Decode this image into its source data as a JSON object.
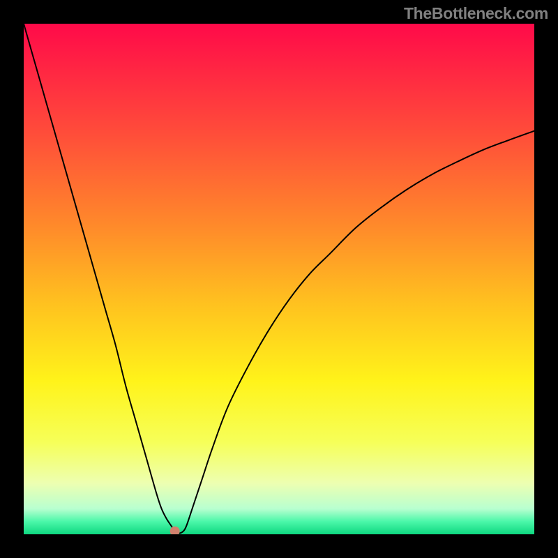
{
  "attribution": "TheBottleneck.com",
  "chart_data": {
    "type": "line",
    "title": "",
    "xlabel": "",
    "ylabel": "",
    "xlim": [
      0,
      100
    ],
    "ylim": [
      0,
      100
    ],
    "background": {
      "type": "vertical-gradient",
      "stops": [
        {
          "pos": 0.0,
          "color": "#ff0a49"
        },
        {
          "pos": 0.2,
          "color": "#ff483b"
        },
        {
          "pos": 0.4,
          "color": "#ff8b2a"
        },
        {
          "pos": 0.55,
          "color": "#ffc21f"
        },
        {
          "pos": 0.7,
          "color": "#fff31a"
        },
        {
          "pos": 0.82,
          "color": "#f6ff59"
        },
        {
          "pos": 0.9,
          "color": "#edffb1"
        },
        {
          "pos": 0.95,
          "color": "#b8ffd0"
        },
        {
          "pos": 0.975,
          "color": "#4bf7a9"
        },
        {
          "pos": 1.0,
          "color": "#0ed880"
        }
      ]
    },
    "series": [
      {
        "name": "bottleneck-curve",
        "color": "#000000",
        "stroke_width": 2,
        "x": [
          0,
          2,
          4,
          6,
          8,
          10,
          12,
          14,
          16,
          18,
          20,
          22,
          24,
          26,
          27,
          28,
          29,
          29.6,
          30,
          30.5,
          31,
          31.5,
          32,
          33,
          35,
          37,
          40,
          44,
          48,
          52,
          56,
          60,
          65,
          70,
          75,
          80,
          85,
          90,
          95,
          100
        ],
        "y": [
          100,
          93,
          86,
          79,
          72,
          65,
          58,
          51,
          44,
          37,
          29,
          22,
          15,
          8,
          5,
          3,
          1.5,
          0.6,
          0.3,
          0.2,
          0.4,
          0.9,
          2,
          5,
          11,
          17,
          25,
          33,
          40,
          46,
          51,
          55,
          60,
          64,
          67.5,
          70.5,
          73,
          75.3,
          77.2,
          79
        ]
      }
    ],
    "marker": {
      "name": "optimum-point",
      "x": 29.6,
      "y": 0.6,
      "color": "#d1816d",
      "radius": 7
    }
  }
}
